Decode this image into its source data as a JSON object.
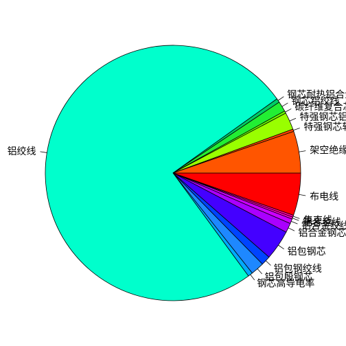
{
  "chart_data": {
    "type": "pie",
    "title": "",
    "start_angle_deg": 0,
    "direction": "clockwise",
    "slices": [
      {
        "label": "布电线",
        "value": 5.4,
        "color": "#FF0000"
      },
      {
        "label": "集束线",
        "value": 0.25,
        "color": "#FF0099"
      },
      {
        "label": "铝合金线",
        "value": 0.25,
        "color": "#FF00CC"
      },
      {
        "label": "铝合金绞线",
        "value": 0.6,
        "color": "#CC00FF"
      },
      {
        "label": "铝合金钢芯",
        "value": 1.2,
        "color": "#AA00FF"
      },
      {
        "label": "铝包钢芯",
        "value": 3.8,
        "color": "#4400FF"
      },
      {
        "label": "铝包钢绞线",
        "value": 1.2,
        "color": "#0044FF"
      },
      {
        "label": "铝包殷钢芯",
        "value": 1.7,
        "color": "#1E88FF"
      },
      {
        "label": "钢芯高导电率",
        "value": 0.6,
        "color": "#00AAFF"
      },
      {
        "label": "铝绞线",
        "value": 75.5,
        "color": "#00FFCC"
      },
      {
        "label": "钢芯耐热铝合金线",
        "value": 0.5,
        "color": "#00CC66"
      },
      {
        "label": "钢芯铝绞线",
        "value": 1.3,
        "color": "#22EE33"
      },
      {
        "label": "碳纤维复合芯",
        "value": 0.3,
        "color": "#66FF00"
      },
      {
        "label": "特强钢芯铝合金",
        "value": 2.2,
        "color": "#99FF00"
      },
      {
        "label": "特强钢芯软铝",
        "value": 0.3,
        "color": "#FF4400"
      },
      {
        "label": "架空绝缘线",
        "value": 5.3,
        "color": "#FF5500"
      }
    ]
  }
}
